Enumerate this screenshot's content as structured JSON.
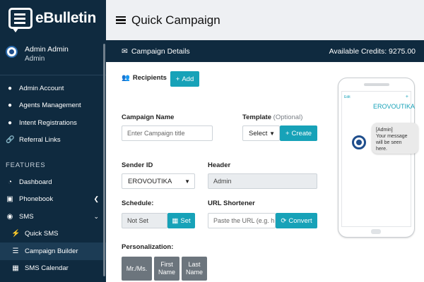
{
  "app": {
    "name": "eBulletin"
  },
  "user": {
    "name": "Admin Admin",
    "role": "Admin"
  },
  "sidebar": {
    "items": [
      {
        "label": "Admin Account",
        "icon": "user-cog-icon"
      },
      {
        "label": "Agents Management",
        "icon": "users-icon"
      },
      {
        "label": "Intent Registrations",
        "icon": "user-tag-icon"
      },
      {
        "label": "Referral Links",
        "icon": "link-icon"
      }
    ],
    "features_title": "FEATURES",
    "features": [
      {
        "label": "Dashboard",
        "icon": "gauge-icon"
      },
      {
        "label": "Phonebook",
        "icon": "address-book-icon"
      },
      {
        "label": "SMS",
        "icon": "sms-icon"
      },
      {
        "label": "Quick SMS",
        "icon": "bolt-icon"
      },
      {
        "label": "Campaign Builder",
        "icon": "bars-icon"
      },
      {
        "label": "SMS Calendar",
        "icon": "calendar-icon"
      }
    ]
  },
  "page": {
    "title": "Quick Campaign"
  },
  "card": {
    "title": "Campaign Details",
    "credits": "Available Credits: 9275.00"
  },
  "recipients": {
    "label": "Recipients",
    "add_label": "Add"
  },
  "campaign_name": {
    "label": "Campaign Name",
    "placeholder": "Enter Campaign title"
  },
  "template": {
    "label": "Template",
    "optional": "(Optional)",
    "select_value": "Select",
    "create_label": "Create"
  },
  "sender_id": {
    "label": "Sender ID",
    "value": "EROVOUTIKA"
  },
  "header": {
    "label": "Header",
    "value": "Admin"
  },
  "schedule": {
    "label": "Schedule:",
    "value": "Not Set",
    "set_label": "Set"
  },
  "url_shortener": {
    "label": "URL Shortener",
    "placeholder": "Paste the URL (e.g. h",
    "convert_label": "Convert"
  },
  "personalization": {
    "label": "Personalization:",
    "tags": [
      "Mr./Ms.",
      "First Name",
      "Last Name"
    ]
  },
  "preview": {
    "sender": "EROVOUTIKA",
    "edit": "Edit",
    "message_line1": "[Admin]",
    "message_line2": "Your message will be seen here."
  },
  "colors": {
    "sidebar": "#0f2a3f",
    "accent": "#17a2b8",
    "tag": "#6c757d"
  }
}
